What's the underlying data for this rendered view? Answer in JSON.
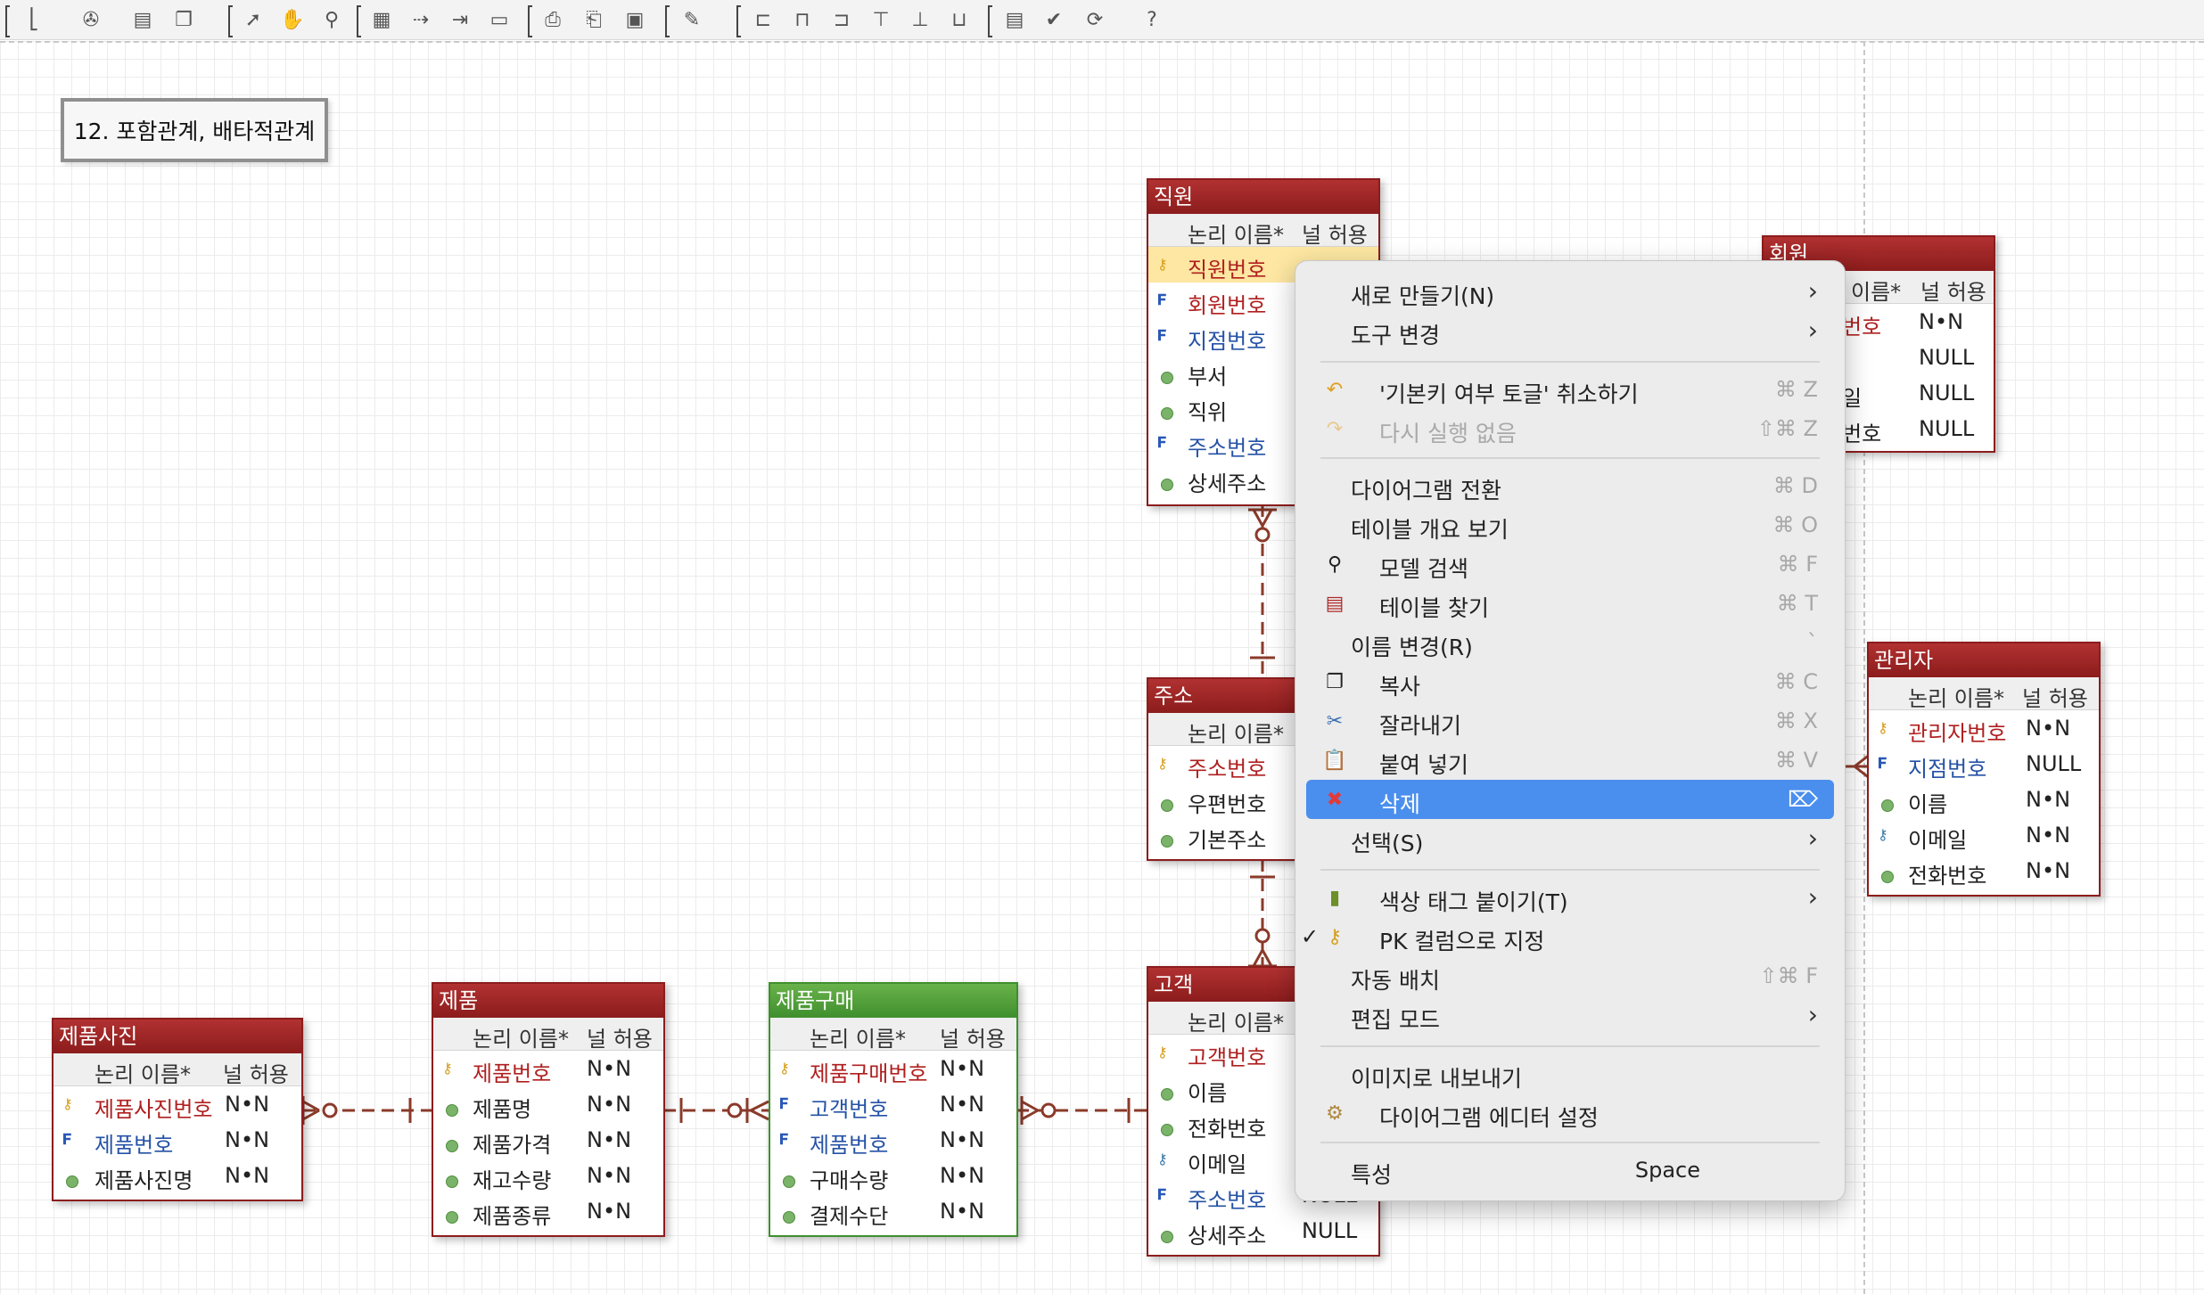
{
  "note": {
    "text": "12. 포함관계, 배타적관계"
  },
  "entities": {
    "employee": {
      "title": "직원",
      "col_name": "논리 이름*",
      "col_null": "널 허용",
      "rows": [
        {
          "name": "직원번호",
          "null": ""
        },
        {
          "name": "회원번호",
          "null": ""
        },
        {
          "name": "지점번호",
          "null": ""
        },
        {
          "name": "부서",
          "null": ""
        },
        {
          "name": "직위",
          "null": ""
        },
        {
          "name": "주소번호",
          "null": ""
        },
        {
          "name": "상세주소",
          "null": ""
        }
      ]
    },
    "member": {
      "title": "회원",
      "col_name": "이름*",
      "col_null": "널 허용",
      "rows": [
        {
          "name": "번호",
          "null": "N•N"
        },
        {
          "name": "",
          "null": "NULL"
        },
        {
          "name": "일",
          "null": "NULL"
        },
        {
          "name": "번호",
          "null": "NULL"
        }
      ]
    },
    "address": {
      "title": "주소",
      "col_name": "논리 이름*",
      "rows": [
        {
          "name": "주소번호"
        },
        {
          "name": "우편번호"
        },
        {
          "name": "기본주소"
        }
      ]
    },
    "admin": {
      "title": "관리자",
      "col_name": "논리 이름*",
      "col_null": "널 허용",
      "rows": [
        {
          "name": "관리자번호",
          "null": "N•N"
        },
        {
          "name": "지점번호",
          "null": "NULL"
        },
        {
          "name": "이름",
          "null": "N•N"
        },
        {
          "name": "이메일",
          "null": "N•N"
        },
        {
          "name": "전화번호",
          "null": "N•N"
        }
      ]
    },
    "customer": {
      "title": "고객",
      "col_name": "논리 이름*",
      "rows": [
        {
          "name": "고객번호",
          "null": ""
        },
        {
          "name": "이름",
          "null": ""
        },
        {
          "name": "전화번호",
          "null": ""
        },
        {
          "name": "이메일",
          "null": ""
        },
        {
          "name": "주소번호",
          "null": "NULL"
        },
        {
          "name": "상세주소",
          "null": "NULL"
        }
      ]
    },
    "photo": {
      "title": "제품사진",
      "col_name": "논리 이름*",
      "col_null": "널 허용",
      "rows": [
        {
          "name": "제품사진번호",
          "null": "N•N"
        },
        {
          "name": "제품번호",
          "null": "N•N"
        },
        {
          "name": "제품사진명",
          "null": "N•N"
        }
      ]
    },
    "product": {
      "title": "제품",
      "col_name": "논리 이름*",
      "col_null": "널 허용",
      "rows": [
        {
          "name": "제품번호",
          "null": "N•N"
        },
        {
          "name": "제품명",
          "null": "N•N"
        },
        {
          "name": "제품가격",
          "null": "N•N"
        },
        {
          "name": "재고수량",
          "null": "N•N"
        },
        {
          "name": "제품종류",
          "null": "N•N"
        }
      ]
    },
    "purchase": {
      "title": "제품구매",
      "col_name": "논리 이름*",
      "col_null": "널 허용",
      "rows": [
        {
          "name": "제품구매번호",
          "null": "N•N"
        },
        {
          "name": "고객번호",
          "null": "N•N"
        },
        {
          "name": "제품번호",
          "null": "N•N"
        },
        {
          "name": "구매수량",
          "null": "N•N"
        },
        {
          "name": "결제수단",
          "null": "N•N"
        }
      ]
    }
  },
  "context_menu": {
    "new": "새로 만들기(N)",
    "change_tool": "도구 변경",
    "undo": "'기본키 여부 토글' 취소하기",
    "undo_sc": "⌘ Z",
    "redo": "다시 실행 없음",
    "redo_sc": "⇧⌘ Z",
    "switch_diagram": "다이어그램 전환",
    "switch_diagram_sc": "⌘ D",
    "table_overview": "테이블 개요 보기",
    "table_overview_sc": "⌘ O",
    "model_search": "모델 검색",
    "model_search_sc": "⌘ F",
    "find_table": "테이블 찾기",
    "find_table_sc": "⌘ T",
    "rename": "이름 변경(R)",
    "rename_sc": "`",
    "copy": "복사",
    "copy_sc": "⌘ C",
    "cut": "잘라내기",
    "cut_sc": "⌘ X",
    "paste": "붙여 넣기",
    "paste_sc": "⌘ V",
    "delete": "삭제",
    "select": "선택(S)",
    "color_tag": "색상 태그 붙이기(T)",
    "pk_column": "PK 컬럼으로 지정",
    "auto_layout": "자동 배치",
    "auto_layout_sc": "⇧⌘ F",
    "edit_mode": "편집 모드",
    "export_image": "이미지로 내보내기",
    "diagram_settings": "다이어그램 에디터 설정",
    "properties": "특성",
    "properties_sc": "Space"
  }
}
